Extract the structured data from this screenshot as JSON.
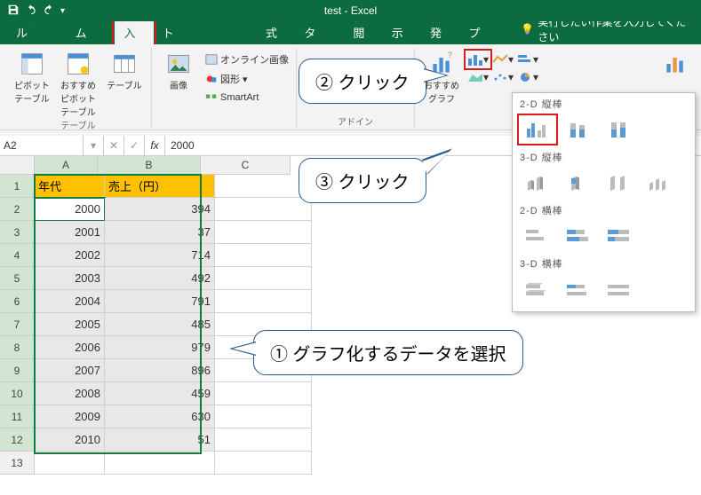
{
  "title": "test - Excel",
  "tabs": [
    "ファイル",
    "ホーム",
    "挿入",
    "ページ レイアウト",
    "数式",
    "データ",
    "校閲",
    "表示",
    "開発",
    "ヘルプ"
  ],
  "tellme_placeholder": "実行したい作業を入力してください",
  "ribbon": {
    "pivot_table": "ピボット\nテーブル",
    "rec_pivot": "おすすめ\nピボットテーブル",
    "table": "テーブル",
    "group_tables": "テーブル",
    "pictures": "画像",
    "online_pictures": "オンライン画像",
    "shapes": "図形",
    "smartart": "SmartArt",
    "group_addins": "アドイン",
    "rec_charts": "おすすめ\nグラフ"
  },
  "chart_menu": {
    "sec2d_col": "2-D 縦棒",
    "sec3d_col": "3-D 縦棒",
    "sec2d_bar": "2-D 横棒",
    "sec3d_bar": "3-D 横棒"
  },
  "name_box": "A2",
  "formula": "2000",
  "columns": [
    "A",
    "B",
    "C"
  ],
  "header_row": {
    "A": "年代",
    "B": "売上（円）"
  },
  "data": [
    {
      "row": 2,
      "A": "2000",
      "B": "394"
    },
    {
      "row": 3,
      "A": "2001",
      "B": "37"
    },
    {
      "row": 4,
      "A": "2002",
      "B": "714"
    },
    {
      "row": 5,
      "A": "2003",
      "B": "492"
    },
    {
      "row": 6,
      "A": "2004",
      "B": "791"
    },
    {
      "row": 7,
      "A": "2005",
      "B": "485"
    },
    {
      "row": 8,
      "A": "2006",
      "B": "979"
    },
    {
      "row": 9,
      "A": "2007",
      "B": "896"
    },
    {
      "row": 10,
      "A": "2008",
      "B": "459"
    },
    {
      "row": 11,
      "A": "2009",
      "B": "630"
    },
    {
      "row": 12,
      "A": "2010",
      "B": "51"
    }
  ],
  "callouts": {
    "c1": "① グラフ化するデータを選択",
    "c2": "② クリック",
    "c3": "③ クリック"
  }
}
